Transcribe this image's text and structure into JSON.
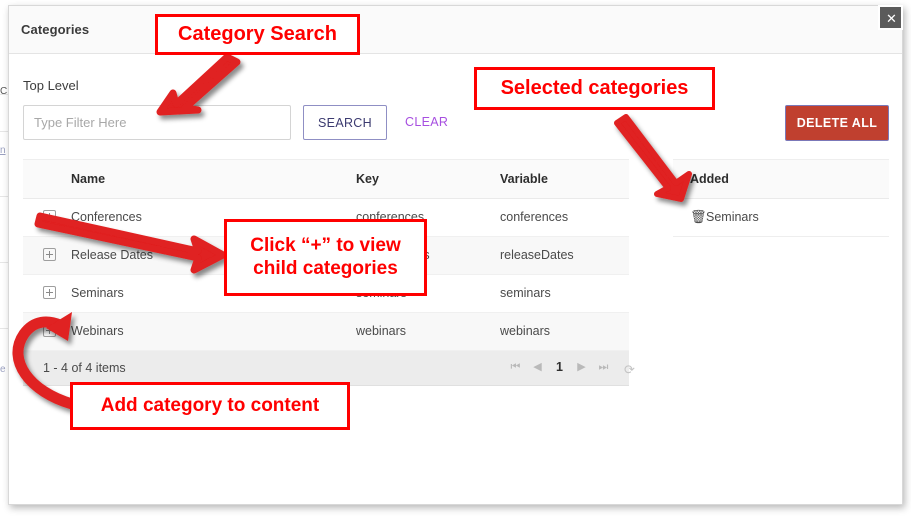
{
  "dialog": {
    "title": "Categories",
    "close_label": "✕",
    "close_icon": "close-icon"
  },
  "filters": {
    "scope_label": "Top Level",
    "input_value": "",
    "input_placeholder": "Type Filter Here",
    "search_label": "SEARCH",
    "clear_label": "CLEAR",
    "delete_all_label": "DELETE ALL"
  },
  "table": {
    "columns": [
      "Name",
      "Key",
      "Variable"
    ],
    "rows": [
      {
        "expand_icon": "plus-square-icon",
        "name": "Conferences",
        "key": "conferences",
        "variable": "conferences"
      },
      {
        "expand_icon": "plus-square-icon",
        "name": "Release Dates",
        "key": "releaseDates",
        "variable": "releaseDates"
      },
      {
        "expand_icon": "plus-square-icon",
        "name": "Seminars",
        "key": "seminars",
        "variable": "seminars"
      },
      {
        "expand_icon": "plus-square-icon",
        "name": "Webinars",
        "key": "webinars",
        "variable": "webinars"
      }
    ],
    "footer": {
      "item_count": "1 - 4 of 4 items",
      "pager": {
        "first": "⏮",
        "prev": "◀",
        "current_page": "1",
        "next": "▶",
        "last": "⏭",
        "refresh": "⟳"
      }
    }
  },
  "added": {
    "header": "Added",
    "items": [
      {
        "trash_icon": "trash-icon",
        "label": "Seminars"
      }
    ]
  },
  "annotations": [
    {
      "id": "anno-search",
      "text": "Category Search"
    },
    {
      "id": "anno-selected",
      "text": "Selected categories"
    },
    {
      "id": "anno-plus",
      "text": "Click “+” to view child categories"
    },
    {
      "id": "anno-add",
      "text": "Add category to content"
    }
  ],
  "colors": {
    "annotation_red": "#ff0000",
    "delete_all_bg": "#c0402f",
    "search_text": "#3b3a70",
    "clear_text": "#a74fe0"
  },
  "background_page": {
    "fragment_1": "C",
    "fragment_2": "n",
    "fragment_3": "e"
  }
}
